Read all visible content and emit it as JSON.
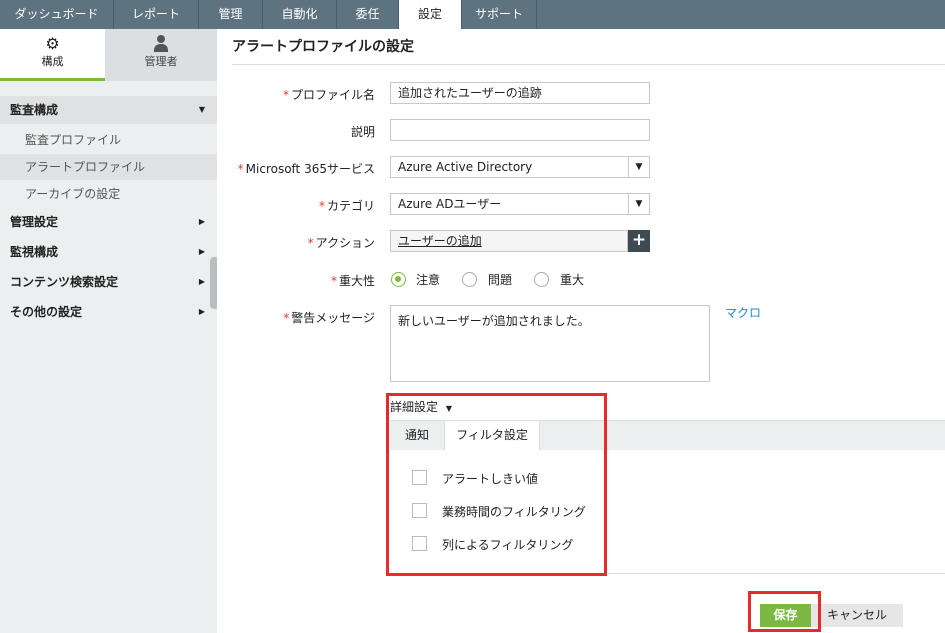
{
  "nav": {
    "tabs": [
      "ダッシュボード",
      "レポート",
      "管理",
      "自動化",
      "委任",
      "設定",
      "サポート"
    ],
    "active": 5
  },
  "sidebar": {
    "tabs": [
      {
        "label": "構成",
        "icon": "gear-icon"
      },
      {
        "label": "管理者",
        "icon": "user-icon"
      }
    ],
    "sections": [
      {
        "label": "監査構成",
        "expanded": true,
        "items": [
          "監査プロファイル",
          "アラートプロファイル",
          "アーカイブの設定"
        ],
        "selected": 1
      },
      {
        "label": "管理設定"
      },
      {
        "label": "監視構成"
      },
      {
        "label": "コンテンツ検索設定"
      },
      {
        "label": "その他の設定"
      }
    ]
  },
  "page": {
    "title": "アラートプロファイルの設定"
  },
  "form": {
    "required_mark": "*",
    "profile_name": {
      "label": "プロファイル名",
      "value": "追加されたユーザーの追跡"
    },
    "description": {
      "label": "説明",
      "value": ""
    },
    "service": {
      "label": "Microsoft 365サービス",
      "value": "Azure Active Directory"
    },
    "category": {
      "label": "カテゴリ",
      "value": "Azure ADユーザー"
    },
    "action": {
      "label": "アクション",
      "value": "ユーザーの追加"
    },
    "severity": {
      "label": "重大性",
      "options": [
        "注意",
        "問題",
        "重大"
      ],
      "selected": 0
    },
    "message": {
      "label": "警告メッセージ",
      "value": "新しいユーザーが追加されました。",
      "macro_link": "マクロ"
    }
  },
  "advanced": {
    "label": "詳細設定",
    "tabs": [
      "通知",
      "フィルタ設定"
    ],
    "active_tab": 1,
    "filters": [
      {
        "label": "アラートしきい値",
        "checked": false
      },
      {
        "label": "業務時間のフィルタリング",
        "checked": false
      },
      {
        "label": "列によるフィルタリング",
        "checked": false
      }
    ]
  },
  "buttons": {
    "save": "保存",
    "cancel": "キャンセル"
  },
  "colors": {
    "accent": "#7cb942",
    "nav": "#5e7380",
    "highlight": "#e52b2b"
  }
}
